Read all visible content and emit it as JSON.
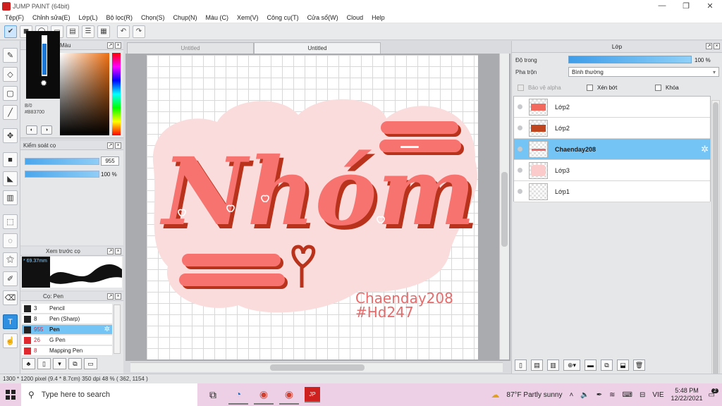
{
  "window": {
    "title": "JUMP PAINT (64bit)",
    "controls": [
      "—",
      "❐",
      "✕"
    ]
  },
  "menu": [
    "Tệp(F)",
    "Chỉnh sửa(E)",
    "Lớp(L)",
    "Bộ lọc(R)",
    "Chọn(S)",
    "Chụp(N)",
    "Màu (C)",
    "Xem(V)",
    "Công cụ(T)",
    "Cửa sổ(W)",
    "Cloud",
    "Help"
  ],
  "color_panel": {
    "title": "Màu",
    "label": "B/0",
    "hex": "#B83700"
  },
  "brush_control": {
    "title": "Kiểm soát cọ",
    "size": "955",
    "opacity": "100 %",
    "size_fill": 0.96,
    "opacity_fill": 1.0
  },
  "brush_preview": {
    "title": "Xem trước cọ",
    "size_readout": "* 69.37mm"
  },
  "brush_list": {
    "title": "Cọ: Pen",
    "items": [
      {
        "size": "3",
        "name": "Pencil",
        "color": "#222222",
        "selected": false
      },
      {
        "size": "8",
        "name": "Pen (Sharp)",
        "color": "#222222",
        "selected": false
      },
      {
        "size": "955",
        "name": "Pen",
        "color": "#222222",
        "selected": true
      },
      {
        "size": "26",
        "name": "G Pen",
        "color": "#e0282e",
        "selected": false
      },
      {
        "size": "8",
        "name": "Mapping Pen",
        "color": "#e0282e",
        "selected": false
      }
    ]
  },
  "tabs": [
    {
      "label": "Untitled",
      "active": false
    },
    {
      "label": "Untitled",
      "active": true
    }
  ],
  "artwork": {
    "main_text": "Nhóm",
    "signature_line1": "Chaenday208",
    "signature_line2": "#Hd247",
    "colors": {
      "fill": "#f7736f",
      "shadow": "#b8321c",
      "cloud": "#fbdcdc"
    }
  },
  "layers_panel": {
    "title": "Lớp",
    "opacity_label": "Độ trong",
    "opacity_value": "100 %",
    "blend_label": "Pha trộn",
    "blend_value": "Bình thường",
    "protect_alpha": "Bảo vệ alpha",
    "clipping": "Xén bớt",
    "lock": "Khóa",
    "layers": [
      {
        "name": "Lớp2",
        "selected": false
      },
      {
        "name": "Lớp2",
        "selected": false
      },
      {
        "name": "Chaenday208",
        "selected": true
      },
      {
        "name": "Lớp3",
        "selected": false
      },
      {
        "name": "Lớp1",
        "selected": false
      }
    ]
  },
  "status": {
    "text": "1300 * 1200 pixel  (9.4 * 8.7cm)  350 dpi  48 %  ( 362, 1154 )"
  },
  "taskbar": {
    "search_placeholder": "Type here to search",
    "weather": "87°F  Partly sunny",
    "language": "VIE",
    "time": "5:48 PM",
    "date": "12/22/2021",
    "notifications": "2"
  }
}
